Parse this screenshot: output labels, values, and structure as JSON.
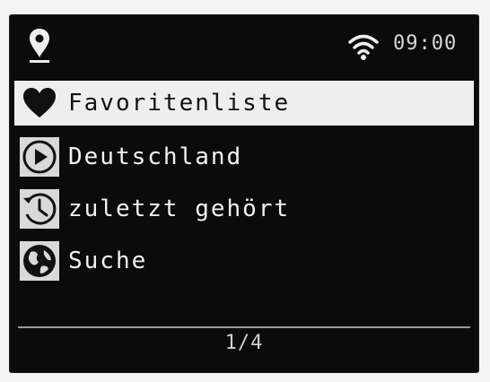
{
  "status_bar": {
    "time": "09:00",
    "location_icon": "location-pin-icon",
    "wifi_icon": "wifi-icon"
  },
  "menu": {
    "items": [
      {
        "label": "Favoritenliste",
        "icon": "heart-icon",
        "selected": true
      },
      {
        "label": "Deutschland",
        "icon": "play-icon",
        "selected": false
      },
      {
        "label": "zuletzt gehört",
        "icon": "history-clock-icon",
        "selected": false
      },
      {
        "label": "Suche",
        "icon": "globe-icon",
        "selected": false
      }
    ]
  },
  "pager": {
    "text": "1/4"
  },
  "colors": {
    "screen_background": "#0b0b0b",
    "selection_background": "#eeeeee",
    "text": "#f2f2f2"
  }
}
